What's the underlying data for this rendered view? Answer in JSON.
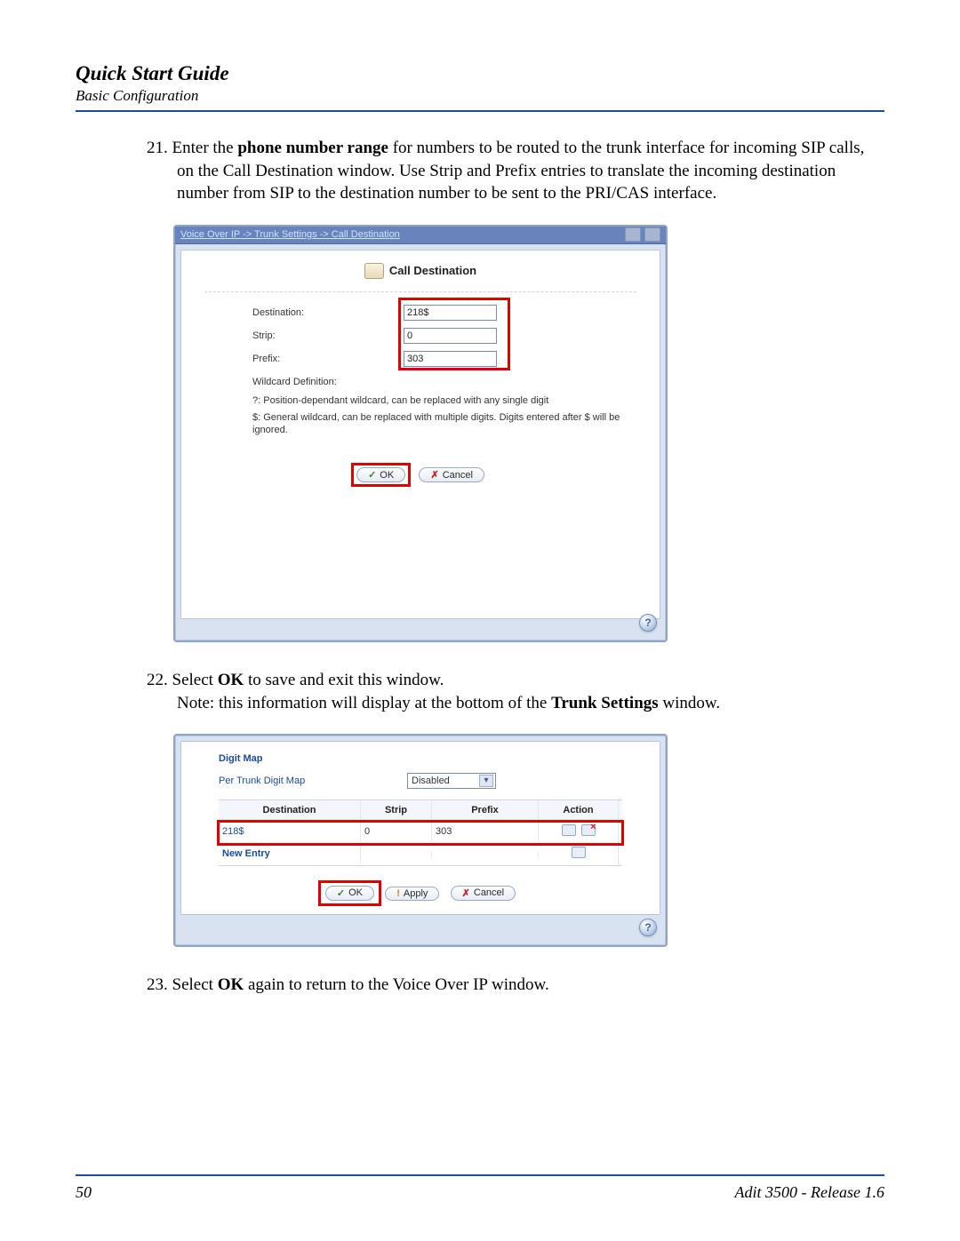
{
  "header": {
    "title": "Quick Start Guide",
    "subtitle": "Basic Configuration"
  },
  "steps": {
    "s21": {
      "num": "21.",
      "t1": "Enter the ",
      "b1": "phone number range",
      "t2": " for numbers to be routed to the trunk interface for incoming SIP calls, on the Call Destination window. Use Strip and Prefix entries to translate the incoming destination number from SIP to the destination number to be sent to the PRI/CAS interface."
    },
    "s22": {
      "num": "22.",
      "t1": "Select ",
      "b1": "OK",
      "t2": " to save and exit this window.",
      "note1": "Note: this information will display at the bottom of the ",
      "noteb": "Trunk Settings",
      "note2": " window."
    },
    "s23": {
      "num": "23.",
      "t1": "Select ",
      "b1": "OK",
      "t2": " again to return to the Voice Over IP window."
    }
  },
  "panel1": {
    "breadcrumb": "Voice Over IP -> Trunk Settings -> Call Destination",
    "heading": "Call Destination",
    "destination_label": "Destination:",
    "destination_value": "218$",
    "strip_label": "Strip:",
    "strip_value": "0",
    "prefix_label": "Prefix:",
    "prefix_value": "303",
    "wildcard_title": "Wildcard Definition:",
    "wc_q": "?: Position-dependant wildcard, can be replaced with any single digit",
    "wc_d": "$: General wildcard, can be replaced with multiple digits. Digits entered after $ will be ignored.",
    "ok": "OK",
    "cancel": "Cancel"
  },
  "panel2": {
    "section": "Digit Map",
    "ptdm_label": "Per Trunk Digit Map",
    "ptdm_value": "Disabled",
    "cols": {
      "c1": "Destination",
      "c2": "Strip",
      "c3": "Prefix",
      "c4": "Action"
    },
    "row1": {
      "dest": "218$",
      "strip": "0",
      "prefix": "303"
    },
    "new_entry": "New Entry",
    "ok": "OK",
    "apply": "Apply",
    "cancel": "Cancel"
  },
  "footer": {
    "page": "50",
    "release": "Adit 3500  - Release 1.6"
  },
  "help": "?"
}
